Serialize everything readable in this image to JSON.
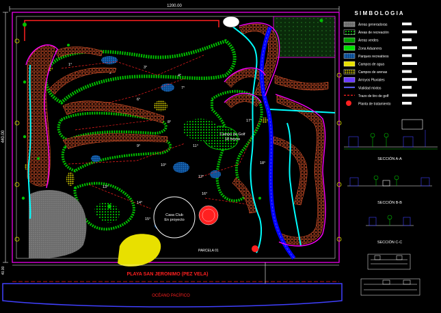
{
  "plan": {
    "dim_width": "1200.00",
    "dim_height": "440.00",
    "dim_bottom": "40.00",
    "beach_label": "PLAYA SAN JERONIMO (PEZ VELA)",
    "ocean_label": "OCÉANO PACÍFICO",
    "golf_label_1": "Campo de Golf",
    "golf_label_2": "18 hoyos",
    "club_label_1": "Casa Club",
    "club_label_2": "En proyecto",
    "seccion_label": "PARCELA 01",
    "hole_labels": [
      "1°",
      "2°",
      "3°",
      "4°",
      "5°",
      "6°",
      "7°",
      "8°",
      "9°",
      "10°",
      "11°",
      "12°",
      "13°",
      "14°",
      "15°",
      "16°",
      "17°",
      "18°"
    ]
  },
  "legend": {
    "title": "S I M B O L O G I A",
    "items": [
      {
        "label": "Áreas generadoras",
        "color": "#7a7a7a",
        "pattern": "grey"
      },
      {
        "label": "Áreas de recreación",
        "color": "#00c000",
        "pattern": "green-dots"
      },
      {
        "label": "Áreas verdes",
        "color": "#00a000",
        "pattern": "green"
      },
      {
        "label": "Zona Aduanera",
        "color": "#00e000",
        "pattern": "green-dark"
      },
      {
        "label": "Parques recreativos",
        "color": "#2aa0ff",
        "pattern": "blue"
      },
      {
        "label": "Campos de agua",
        "color": "#e8e000",
        "pattern": "yellow"
      },
      {
        "label": "Campos de arenas",
        "color": "#e8e000",
        "pattern": "yellow-dots"
      },
      {
        "label": "Arroyos Pluviales",
        "color": "#8080ff",
        "pattern": "purple"
      },
      {
        "label": "Vialidad mixtos",
        "color": "#6060ff",
        "pattern": "line"
      },
      {
        "label": "Trazo de tiro de golf",
        "color": "#ff2020",
        "pattern": "dash"
      },
      {
        "label": "Planta de tratamiento",
        "color": "#ff2020",
        "pattern": "circle"
      }
    ]
  },
  "sections": {
    "a": "SECCIÓN A-A",
    "b": "SECCIÓN B-B",
    "c": "SECCIÓN C-C"
  },
  "colors": {
    "boundary": "#ff00ff",
    "road": "#0000ff",
    "green": "#00c000",
    "water": "#00ffff",
    "yellow": "#e8e000",
    "red": "#ff2020",
    "lots": "#ff6030"
  }
}
